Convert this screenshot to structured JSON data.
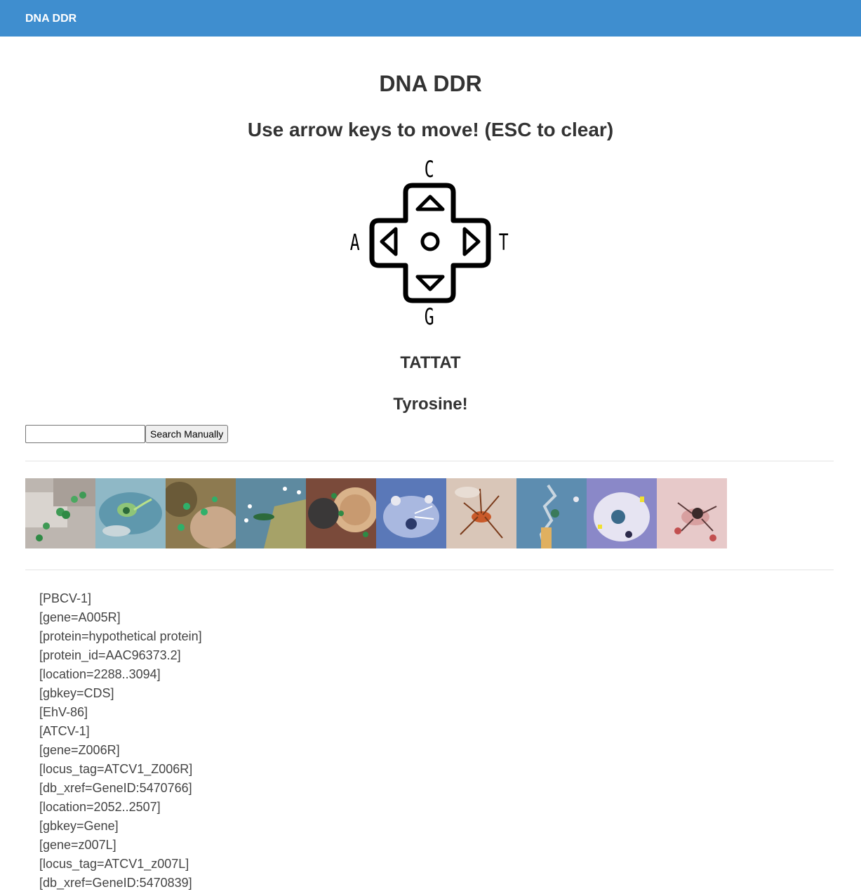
{
  "navbar": {
    "brand": "DNA DDR"
  },
  "header": {
    "title": "DNA DDR",
    "instructions": "Use arrow keys to move! (ESC to clear)"
  },
  "dpad": {
    "up_letter": "C",
    "left_letter": "A",
    "right_letter": "T",
    "down_letter": "G"
  },
  "result": {
    "sequence": "TATTAT",
    "amino_acid": "Tyrosine!"
  },
  "search": {
    "input_value": "",
    "button_label": "Search Manually"
  },
  "gallery": {
    "images": [
      {
        "icon": "green-cells-on-gray-image",
        "colors": [
          "#b9b2ad",
          "#3f9a55"
        ]
      },
      {
        "icon": "green-organism-in-water-image",
        "colors": [
          "#6fa7b8",
          "#9bd16a"
        ]
      },
      {
        "icon": "green-spores-on-skin-image",
        "colors": [
          "#8d7a50",
          "#2fb06a"
        ]
      },
      {
        "icon": "seaweed-water-image",
        "colors": [
          "#5e8aa0",
          "#b8a85a"
        ]
      },
      {
        "icon": "radial-cell-colony-image",
        "colors": [
          "#7a4a3a",
          "#d9b38a"
        ]
      },
      {
        "icon": "blue-microbes-image",
        "colors": [
          "#5a78b8",
          "#e8e8f0"
        ]
      },
      {
        "icon": "orange-insect-image",
        "colors": [
          "#d9c6b8",
          "#c95a2a"
        ]
      },
      {
        "icon": "blue-tendril-image",
        "colors": [
          "#5d8db0",
          "#e0b060"
        ]
      },
      {
        "icon": "purple-cell-image",
        "colors": [
          "#8a88c8",
          "#e6e4f2"
        ]
      },
      {
        "icon": "pink-spider-image",
        "colors": [
          "#e7c9c9",
          "#c24f4f"
        ]
      }
    ]
  },
  "fasta_lines": [
    "[PBCV-1]",
    "[gene=A005R]",
    "[protein=hypothetical protein]",
    "[protein_id=AAC96373.2]",
    "[location=2288..3094]",
    "[gbkey=CDS]",
    "[EhV-86]",
    "[ATCV-1]",
    "[gene=Z006R]",
    "[locus_tag=ATCV1_Z006R]",
    "[db_xref=GeneID:5470766]",
    "[location=2052..2507]",
    "[gbkey=Gene]",
    "[gene=z007L]",
    "[locus_tag=ATCV1_z007L]",
    "[db_xref=GeneID:5470839]"
  ]
}
